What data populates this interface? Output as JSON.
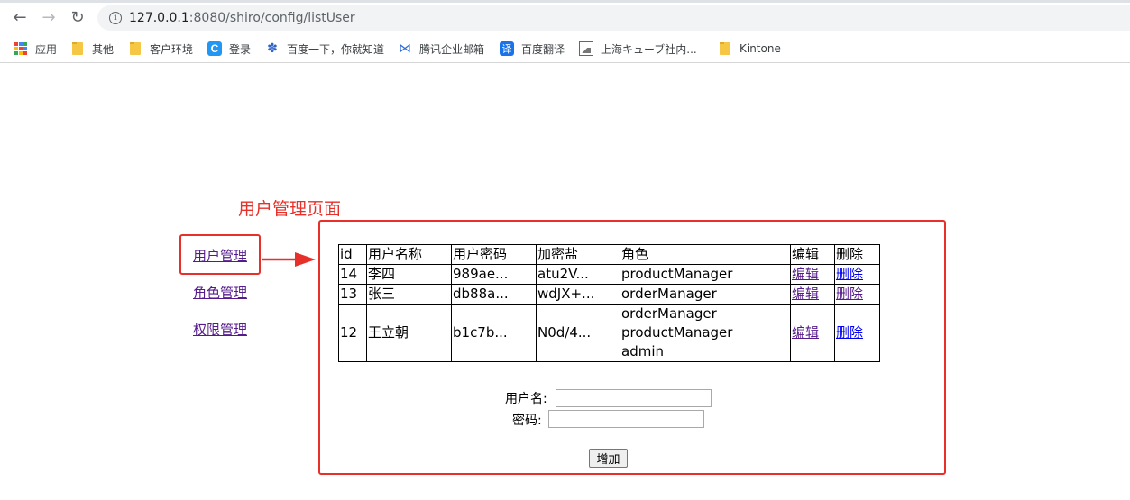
{
  "browser": {
    "url_host": "127.0.0.1",
    "url_path": ":8080/shiro/config/listUser",
    "bookmarks": [
      {
        "label": "应用",
        "icon": "apps-grid-icon"
      },
      {
        "label": "其他",
        "icon": "folder-icon"
      },
      {
        "label": "客户环境",
        "icon": "folder-icon"
      },
      {
        "label": "登录",
        "icon": "c-logo-icon"
      },
      {
        "label": "百度一下，你就知道",
        "icon": "baidu-paw-icon"
      },
      {
        "label": "腾讯企业邮箱",
        "icon": "tencent-mail-icon"
      },
      {
        "label": "百度翻译",
        "icon": "baidu-translate-icon"
      },
      {
        "label": "上海キューブ社内...",
        "icon": "image-icon"
      },
      {
        "label": "Kintone",
        "icon": "folder-icon"
      }
    ]
  },
  "page": {
    "annotation_title": "用户管理页面",
    "nav": [
      {
        "label": "用户管理"
      },
      {
        "label": "角色管理"
      },
      {
        "label": "权限管理"
      }
    ],
    "table": {
      "headers": [
        "id",
        "用户名称",
        "用户密码",
        "加密盐",
        "角色",
        "编辑",
        "删除"
      ],
      "rows": [
        {
          "id": "14",
          "name": "李四",
          "password": "989ae...",
          "salt": "atu2V...",
          "roles": [
            "productManager"
          ],
          "edit": "编辑",
          "delete": "删除"
        },
        {
          "id": "13",
          "name": "张三",
          "password": "db88a...",
          "salt": "wdJX+...",
          "roles": [
            "orderManager"
          ],
          "edit": "编辑",
          "delete": "删除"
        },
        {
          "id": "12",
          "name": "王立朝",
          "password": "b1c7b...",
          "salt": "N0d/4...",
          "roles": [
            "orderManager",
            "productManager",
            "admin"
          ],
          "edit": "编辑",
          "delete": "删除"
        }
      ]
    },
    "form": {
      "username_label": "用户名:",
      "username_value": "",
      "password_label": "密码:",
      "password_value": "",
      "submit_label": "增加"
    }
  },
  "colors": {
    "annotation_red": "#e8302a",
    "link_blue": "#0000ee",
    "visited_purple": "#551a8b"
  }
}
